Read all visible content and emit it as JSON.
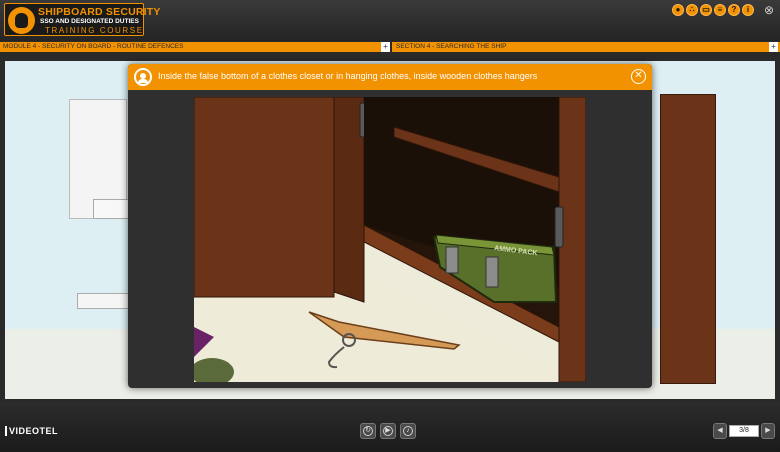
{
  "app": {
    "logo": {
      "title": "SHIPBOARD SECURITY",
      "subtitle": "SSO AND DESIGNATED DUTIES",
      "course": "TRAINING COURSE"
    },
    "top_icons": [
      "person-icon",
      "group-icon",
      "book-icon",
      "document-icon",
      "help-icon",
      "info-icon"
    ],
    "close_glyph": "⊗"
  },
  "nav": {
    "module": "MODULE 4 - SECURITY ON BOARD - ROUTINE DEFENCES",
    "section": "SECTION 4 - SEARCHING THE SHIP",
    "expand_glyph": "+"
  },
  "popup": {
    "text": "Inside the false bottom of a clothes closet or in hanging clothes, inside wooden clothes hangers",
    "close_glyph": "✕",
    "crate_label": "AMMO PACK"
  },
  "footer": {
    "brand": "VIDEOTEL",
    "page": "3/8"
  },
  "colors": {
    "accent": "#f39200",
    "bar": "#2a2a2a",
    "wood": "#6b3317"
  }
}
